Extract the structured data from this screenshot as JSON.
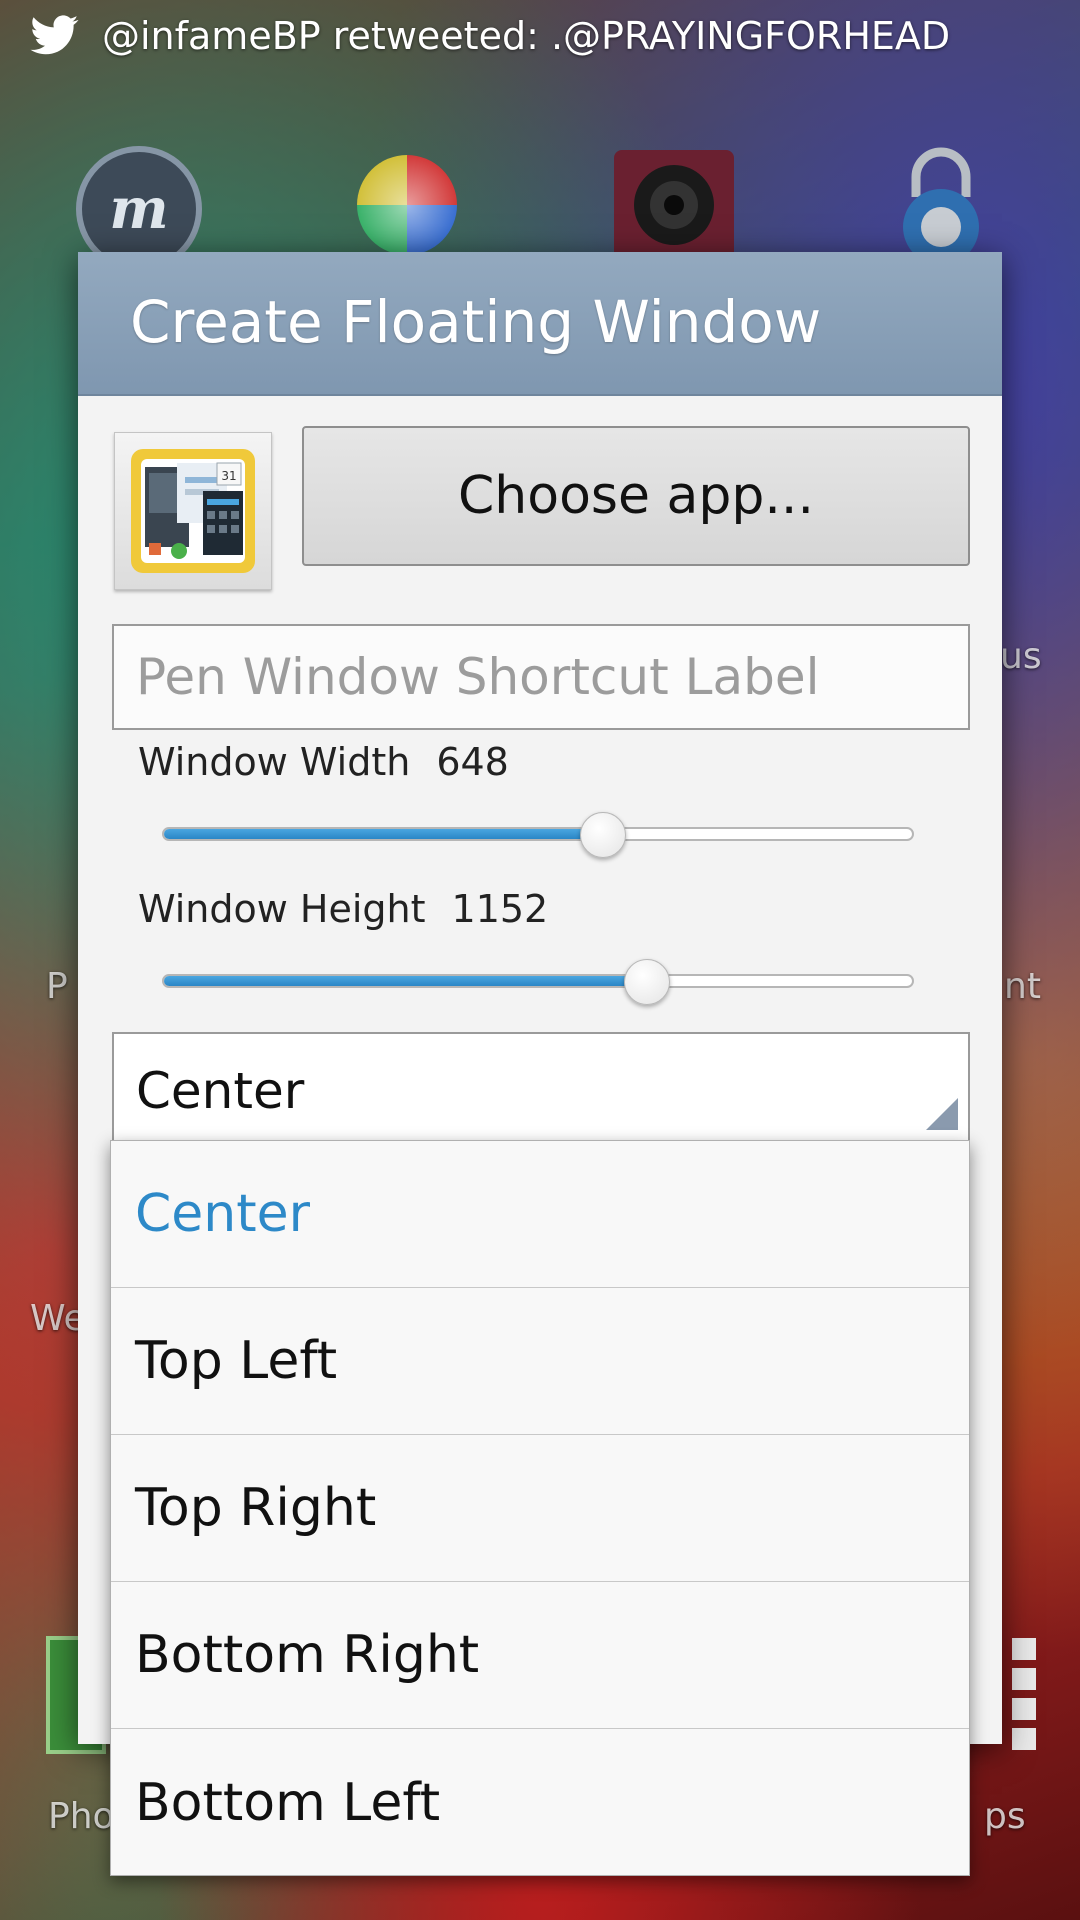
{
  "status_bar": {
    "icon": "twitter-bird-icon",
    "notification": "@infameBP retweeted: .@PRAYINGFORHEAD"
  },
  "home": {
    "labels": {
      "left_mid": "P",
      "right_mid": "nt",
      "left_low": "We",
      "right_upper": "us",
      "dock_left": "Pho",
      "dock_right": "ps"
    }
  },
  "dialog": {
    "title": "Create Floating Window",
    "choose_app_label": "Choose app...",
    "shortcut_label_placeholder": "Pen Window Shortcut Label",
    "shortcut_label_value": "",
    "width": {
      "label": "Window Width",
      "value": "648",
      "fraction": 0.585
    },
    "height": {
      "label": "Window Height",
      "value": "1152",
      "fraction": 0.645
    },
    "position_select": {
      "selected": "Center"
    }
  },
  "dropdown": {
    "options": [
      "Center",
      "Top Left",
      "Top Right",
      "Bottom Right",
      "Bottom Left"
    ],
    "selected_index": 0
  },
  "colors": {
    "accent_blue": "#2d89c8",
    "header_blue_grey": "#8aa1b8",
    "dialog_bg": "#f3f3f3"
  }
}
